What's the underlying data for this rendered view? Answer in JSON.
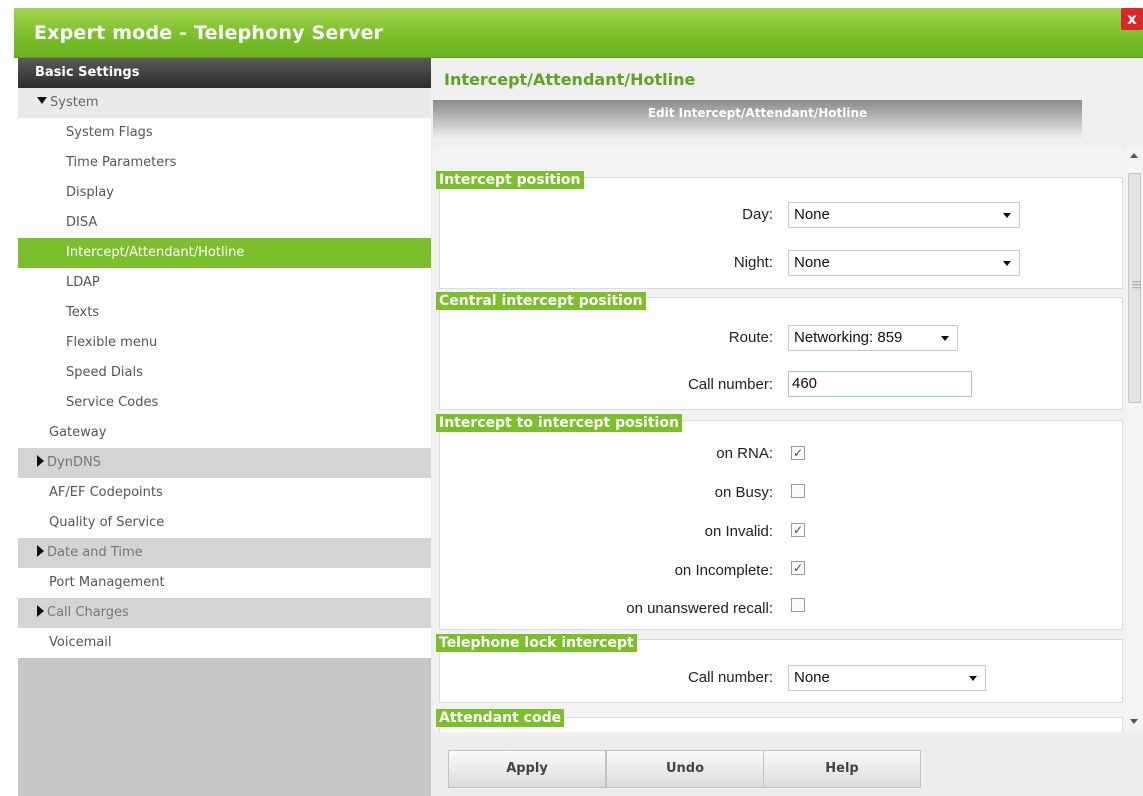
{
  "window": {
    "title": "Expert mode - Telephony Server",
    "close_label": "x"
  },
  "sidebar": {
    "header": "Basic Settings",
    "items": [
      {
        "label": "System",
        "kind": "group-open"
      },
      {
        "label": "System Flags",
        "kind": "l2"
      },
      {
        "label": "Time Parameters",
        "kind": "l2"
      },
      {
        "label": "Display",
        "kind": "l2"
      },
      {
        "label": "DISA",
        "kind": "l2"
      },
      {
        "label": "Intercept/Attendant/Hotline",
        "kind": "active"
      },
      {
        "label": "LDAP",
        "kind": "l2"
      },
      {
        "label": "Texts",
        "kind": "l2"
      },
      {
        "label": "Flexible menu",
        "kind": "l2"
      },
      {
        "label": "Speed Dials",
        "kind": "l2"
      },
      {
        "label": "Service Codes",
        "kind": "l2"
      },
      {
        "label": "Gateway",
        "kind": "l1"
      },
      {
        "label": "DynDNS",
        "kind": "group"
      },
      {
        "label": "AF/EF Codepoints",
        "kind": "l1"
      },
      {
        "label": "Quality of Service",
        "kind": "l1"
      },
      {
        "label": "Date and Time",
        "kind": "group"
      },
      {
        "label": "Port Management",
        "kind": "l1"
      },
      {
        "label": "Call Charges",
        "kind": "group"
      },
      {
        "label": "Voicemail",
        "kind": "l1"
      }
    ]
  },
  "main": {
    "title": "Intercept/Attendant/Hotline",
    "subtitle": "Edit Intercept/Attendant/Hotline",
    "sections": {
      "intercept_position": {
        "header": "Intercept position",
        "day_label": "Day:",
        "day_value": "None",
        "night_label": "Night:",
        "night_value": "None"
      },
      "central_intercept": {
        "header": "Central intercept position",
        "route_label": "Route:",
        "route_value": "Networking: 859",
        "call_number_label": "Call number:",
        "call_number_value": "460"
      },
      "intercept_to_position": {
        "header": "Intercept to intercept position",
        "on_rna_label": "on RNA:",
        "on_rna_checked": true,
        "on_busy_label": "on Busy:",
        "on_busy_checked": false,
        "on_invalid_label": "on Invalid:",
        "on_invalid_checked": true,
        "on_incomplete_label": "on Incomplete:",
        "on_incomplete_checked": true,
        "on_unanswered_label": "on unanswered recall:",
        "on_unanswered_checked": false
      },
      "telephone_lock": {
        "header": "Telephone lock intercept",
        "call_number_label": "Call number:",
        "call_number_value": "None"
      },
      "attendant_code": {
        "header": "Attendant code"
      }
    },
    "check_glyph": "✓"
  },
  "buttons": {
    "apply": "Apply",
    "undo": "Undo",
    "help": "Help"
  }
}
